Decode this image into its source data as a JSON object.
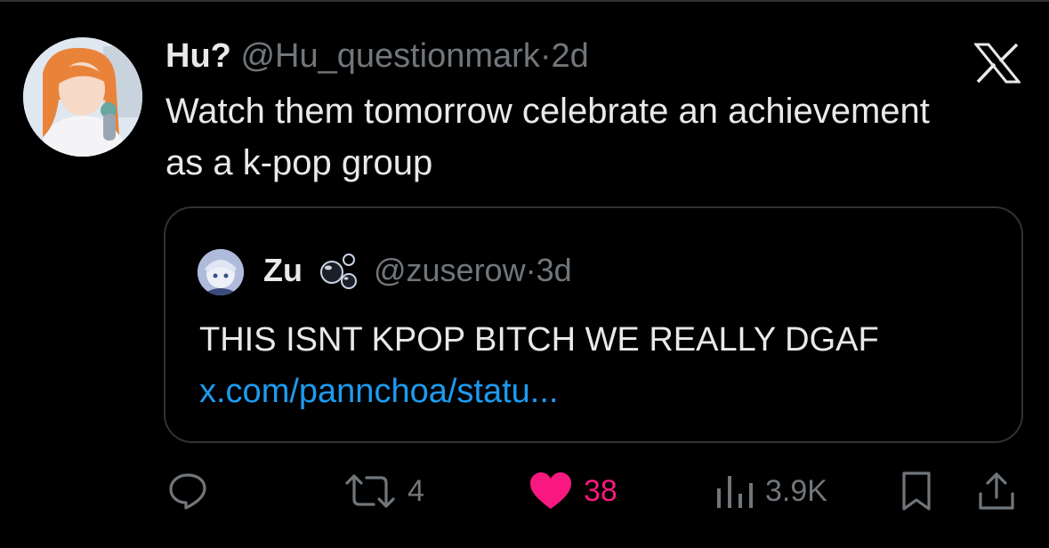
{
  "tweet": {
    "display_name": "Hu?",
    "handle": "@Hu_questionmark",
    "separator": "·",
    "time": "2d",
    "text": "Watch them tomorrow celebrate an achievement as a k-pop group"
  },
  "quoted": {
    "display_name": "Zu",
    "handle": "@zuserow",
    "separator": "·",
    "time": "3d",
    "text": "THIS ISNT KPOP BITCH WE REALLY DGAF",
    "link": "x.com/pannchoa/statu..."
  },
  "actions": {
    "reply": {
      "icon": "reply-icon"
    },
    "retweet": {
      "icon": "retweet-icon",
      "count": "4"
    },
    "like": {
      "icon": "heart-icon",
      "count": "38",
      "liked": true
    },
    "views": {
      "icon": "views-icon",
      "count": "3.9K"
    },
    "bookmark": {
      "icon": "bookmark-icon"
    },
    "share": {
      "icon": "share-icon"
    }
  },
  "colors": {
    "background": "#000000",
    "text_primary": "#e7e9ea",
    "text_secondary": "#71767b",
    "link": "#1d9bf0",
    "like": "#f91880",
    "border": "#2f3336"
  }
}
